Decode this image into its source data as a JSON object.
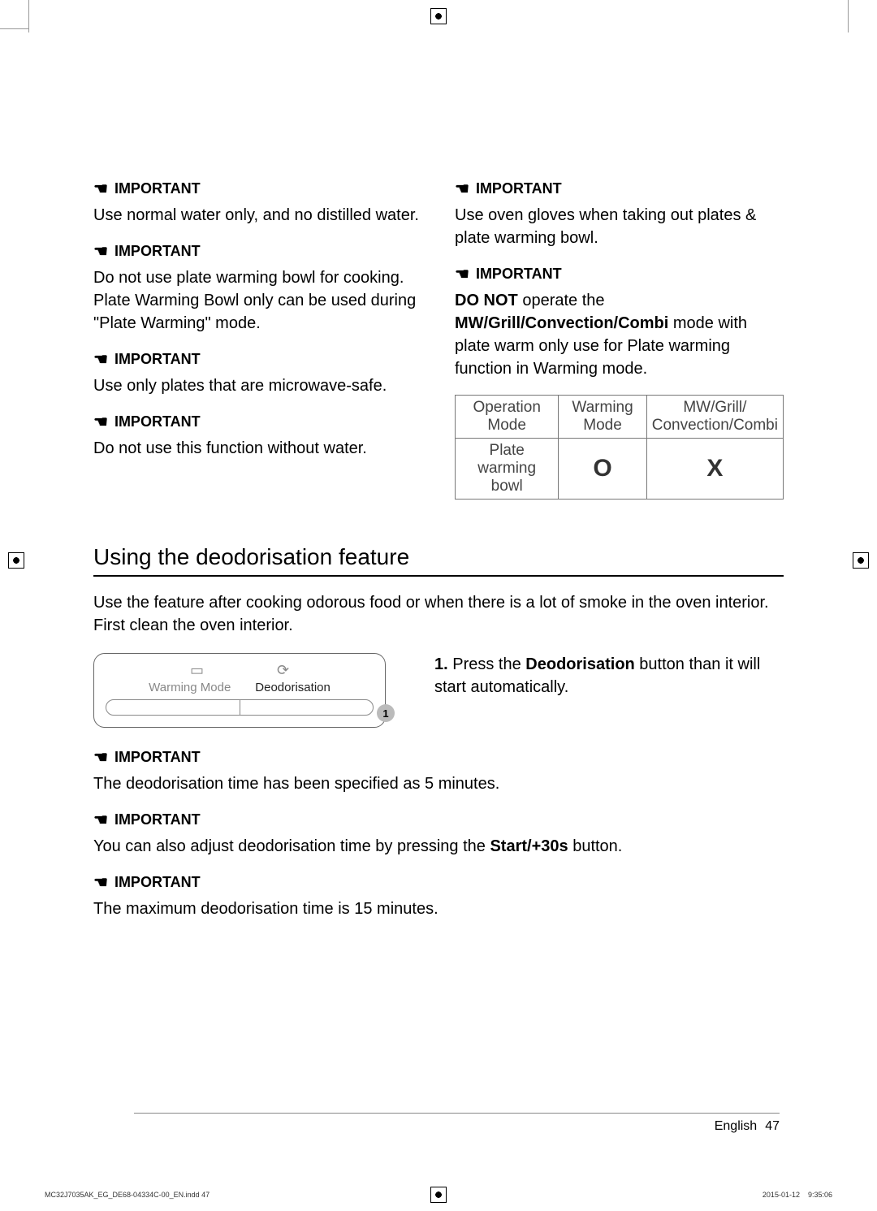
{
  "labels": {
    "important": "IMPORTANT"
  },
  "left_col": {
    "imp1": "Use normal water only, and no distilled water.",
    "imp2": "Do not use plate warming bowl for cooking. Plate Warming Bowl only can be used during \"Plate Warming\" mode.",
    "imp3": "Use only plates that are microwave-safe.",
    "imp4": "Do not use this function without water."
  },
  "right_col": {
    "imp1": "Use oven gloves when taking out plates & plate warming bowl.",
    "imp2_prefix": "DO NOT",
    "imp2_mid": " operate the ",
    "imp2_bold": "MW/Grill/Convection/Combi",
    "imp2_suffix": " mode with plate warm only use for Plate warming function in Warming mode."
  },
  "table": {
    "h1": "Operation Mode",
    "h2": "Warming Mode",
    "h3": "MW/Grill/\nConvection/Combi",
    "r1": "Plate warming bowl",
    "r2": "O",
    "r3": "X"
  },
  "section": {
    "title": "Using the deodorisation feature",
    "intro": "Use the feature after cooking odorous food or when there is a lot of smoke in the oven interior. First clean the oven interior.",
    "control_label1": "Warming Mode",
    "control_label2": "Deodorisation",
    "callout_num": "1",
    "step1_num": "1.",
    "step1_pre": " Press the ",
    "step1_bold": "Deodorisation",
    "step1_post": " button than it will start automatically.",
    "imp1": "The deodorisation time has been specified as 5 minutes.",
    "imp2_pre": "You can also adjust deodorisation time by pressing the ",
    "imp2_bold": "Start/+30s",
    "imp2_post": " button.",
    "imp3": "The maximum deodorisation time is 15 minutes."
  },
  "footer": {
    "lang": "English",
    "page": "47"
  },
  "print": {
    "left": "MC32J7035AK_EG_DE68-04334C-00_EN.indd   47",
    "right": "2015-01-12     9:35:06"
  }
}
